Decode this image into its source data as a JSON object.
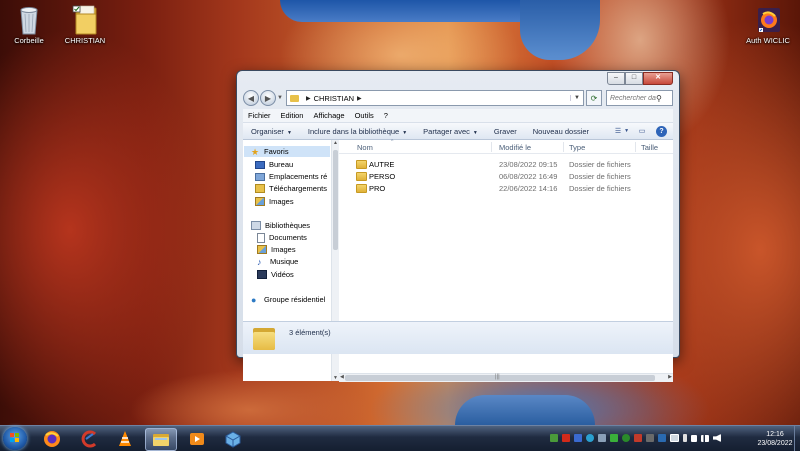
{
  "desktop": {
    "icons": [
      {
        "label": "Corbeille"
      },
      {
        "label": "CHRISTIAN"
      },
      {
        "label": "Auth WICLIC"
      }
    ]
  },
  "window": {
    "address": {
      "segment": "CHRISTIAN"
    },
    "search": {
      "placeholder": "Rechercher dans..."
    },
    "menu": [
      "Fichier",
      "Edition",
      "Affichage",
      "Outils",
      "?"
    ],
    "toolbar": [
      "Organiser",
      "Inclure dans la bibliothèque",
      "Partager avec",
      "Graver",
      "Nouveau dossier"
    ],
    "nav": {
      "favorites": "Favoris",
      "favorites_items": [
        "Bureau",
        "Emplacements ré",
        "Téléchargements",
        "Images"
      ],
      "libraries": "Bibliothèques",
      "libraries_items": [
        "Documents",
        "Images",
        "Musique",
        "Vidéos"
      ],
      "homegroup": "Groupe résidentiel"
    },
    "columns": {
      "name": "Nom",
      "modified": "Modifié le",
      "type": "Type",
      "size": "Taille"
    },
    "files": [
      {
        "name": "AUTRE",
        "modified": "23/08/2022 09:15",
        "type": "Dossier de fichiers"
      },
      {
        "name": "PERSO",
        "modified": "06/08/2022 16:49",
        "type": "Dossier de fichiers"
      },
      {
        "name": "PRO",
        "modified": "22/06/2022 14:16",
        "type": "Dossier de fichiers"
      }
    ],
    "status": "3 élément(s)"
  },
  "taskbar": {
    "apps": [
      "firefox",
      "ccleaner",
      "vlc",
      "windows-explorer",
      "media-player",
      "virtualbox"
    ],
    "clock": {
      "time": "12:16",
      "date": "23/08/2022"
    }
  },
  "colors": {
    "window_frame": "#d6dee9",
    "selection": "#cfe3f8",
    "folder": "#e8c14a",
    "taskbar": "#18243a"
  }
}
